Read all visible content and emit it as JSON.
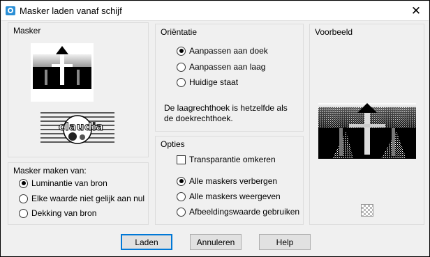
{
  "window": {
    "title": "Masker laden vanaf schijf"
  },
  "masker_group": {
    "title": "Masker",
    "logo_text": "claudia"
  },
  "bron_group": {
    "title": "Masker maken van:",
    "options": [
      {
        "label": "Luminantie van bron",
        "checked": true
      },
      {
        "label": "Elke waarde niet gelijk aan nul",
        "checked": false
      },
      {
        "label": "Dekking van bron",
        "checked": false
      }
    ]
  },
  "orientatie_group": {
    "title": "Oriëntatie",
    "options": [
      {
        "label": "Aanpassen aan doek",
        "checked": true
      },
      {
        "label": "Aanpassen aan laag",
        "checked": false
      },
      {
        "label": "Huidige staat",
        "checked": false
      }
    ],
    "info_line1": "De laagrechthoek is hetzelfde als",
    "info_line2": "de doekrechthoek."
  },
  "opties_group": {
    "title": "Opties",
    "transparency_label": "Transparantie omkeren",
    "transparency_checked": false,
    "options": [
      {
        "label": "Alle maskers verbergen",
        "checked": true
      },
      {
        "label": "Alle maskers weergeven",
        "checked": false
      },
      {
        "label": "Afbeeldingswaarde gebruiken",
        "checked": false
      }
    ]
  },
  "voorbeeld_group": {
    "title": "Voorbeeld"
  },
  "buttons": {
    "load": "Laden",
    "cancel": "Annuleren",
    "help": "Help"
  },
  "icons": {
    "app": "mask-app-icon",
    "close": "close-icon",
    "transparency": "transparency-checker-icon"
  }
}
